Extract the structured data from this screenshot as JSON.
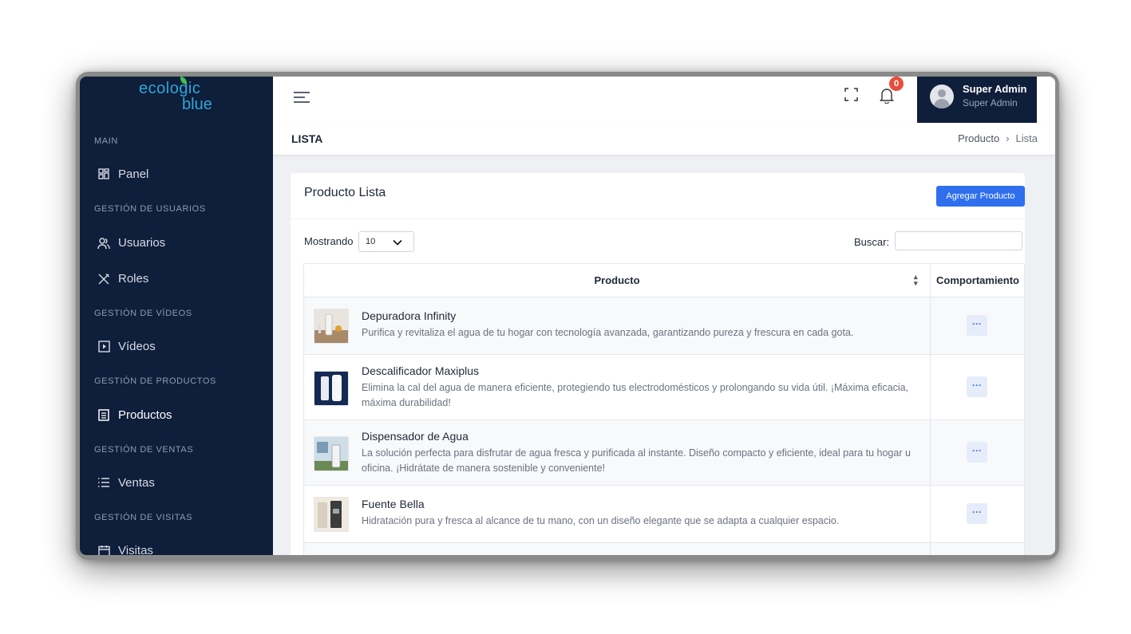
{
  "sidebar": {
    "logo_top": "ecologic",
    "logo_bottom": "blue",
    "sections": {
      "main": "MAIN",
      "usuarios": "GESTIÓN DE USUARIOS",
      "videos": "GESTIÓN DE VÍDEOS",
      "productos": "GESTIÓN DE PRODUCTOS",
      "ventas": "GESTIÓN DE VENTAS",
      "visitas": "GESTIÓN DE VISITAS"
    },
    "items": {
      "panel": "Panel",
      "usuarios": "Usuarios",
      "roles": "Roles",
      "videos": "Vídeos",
      "productos": "Productos",
      "ventas": "Ventas",
      "visitas": "Visitas"
    }
  },
  "topbar": {
    "notifications_count": "0",
    "user_name": "Super Admin",
    "user_role": "Super Admin"
  },
  "page": {
    "title": "LISTA",
    "breadcrumb": [
      "Producto",
      "Lista"
    ]
  },
  "card": {
    "title": "Producto Lista",
    "add_button": "Agregar Producto",
    "show_label": "Mostrando",
    "show_value": "10",
    "search_label": "Buscar:",
    "search_value": ""
  },
  "table": {
    "headers": [
      "Producto",
      "Comportamiento"
    ],
    "rows": [
      {
        "name": "Depuradora Infinity",
        "desc": "Purifica y revitaliza el agua de tu hogar con tecnología avanzada, garantizando pureza y frescura en cada gota.",
        "action": "···"
      },
      {
        "name": "Descalificador Maxiplus",
        "desc": "Elimina la cal del agua de manera eficiente, protegiendo tus electrodomésticos y prolongando su vida útil. ¡Máxima eficacia, máxima durabilidad!",
        "action": "···"
      },
      {
        "name": "Dispensador de Agua",
        "desc": "La solución perfecta para disfrutar de agua fresca y purificada al instante. Diseño compacto y eficiente, ideal para tu hogar u oficina. ¡Hidrátate de manera sostenible y conveniente!",
        "action": "···"
      },
      {
        "name": "Fuente Bella",
        "desc": "Hidratación pura y fresca al alcance de tu mano, con un diseño elegante que se adapta a cualquier espacio.",
        "action": "···"
      }
    ]
  },
  "colors": {
    "sidebar_bg": "#0f1e3a",
    "accent": "#2f6fed",
    "badge": "#e84d3d"
  }
}
